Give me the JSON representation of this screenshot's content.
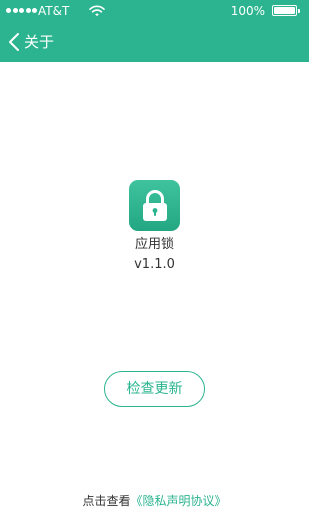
{
  "status_bar": {
    "carrier": "AT&T",
    "battery_percent": "100%",
    "signal_icon": "signal-dots-icon",
    "wifi_icon": "wifi-icon",
    "battery_icon": "battery-icon"
  },
  "nav": {
    "back_icon": "chevron-left-icon",
    "back_label": "关于"
  },
  "app": {
    "icon": "lock-icon",
    "name": "应用锁",
    "version": "v1.1.0"
  },
  "actions": {
    "check_update_label": "检查更新"
  },
  "footer": {
    "prefix": "点击查看",
    "link_label": "《隐私声明协议》"
  },
  "colors": {
    "brand": "#2bb48f",
    "text": "#333333",
    "background": "#ffffff"
  }
}
